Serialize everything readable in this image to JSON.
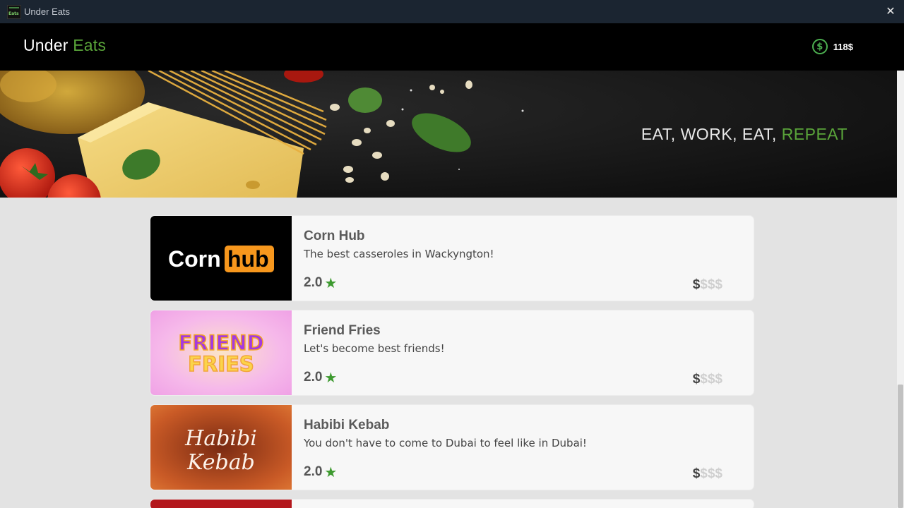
{
  "window": {
    "title": "Under Eats",
    "icon": "app-logo-icon",
    "icon_text": "Eats"
  },
  "header": {
    "brand_part1": "Under",
    "brand_part2": "Eats",
    "wallet_icon": "dollar-coin-icon",
    "wallet_amount": "118$",
    "accent_color": "#5aa53a"
  },
  "hero": {
    "slogan_part1": "EAT, WORK, EAT,",
    "slogan_part2": "REPEAT"
  },
  "restaurants": [
    {
      "name": "Corn Hub",
      "description": "The best casseroles in Wackyngton!",
      "rating": "2.0",
      "price_active": "$",
      "price_inactive": "$$$",
      "logo_text_1": "Corn",
      "logo_text_2": "hub"
    },
    {
      "name": "Friend Fries",
      "description": "Let's become best friends!",
      "rating": "2.0",
      "price_active": "$",
      "price_inactive": "$$$",
      "logo_text_1": "FRIEND",
      "logo_text_2": "FRIES"
    },
    {
      "name": "Habibi Kebab",
      "description": "You don't have to come to Dubai to feel like in Dubai!",
      "rating": "2.0",
      "price_active": "$",
      "price_inactive": "$$$",
      "logo_text_1": "Habibi",
      "logo_text_2": "Kebab"
    }
  ]
}
